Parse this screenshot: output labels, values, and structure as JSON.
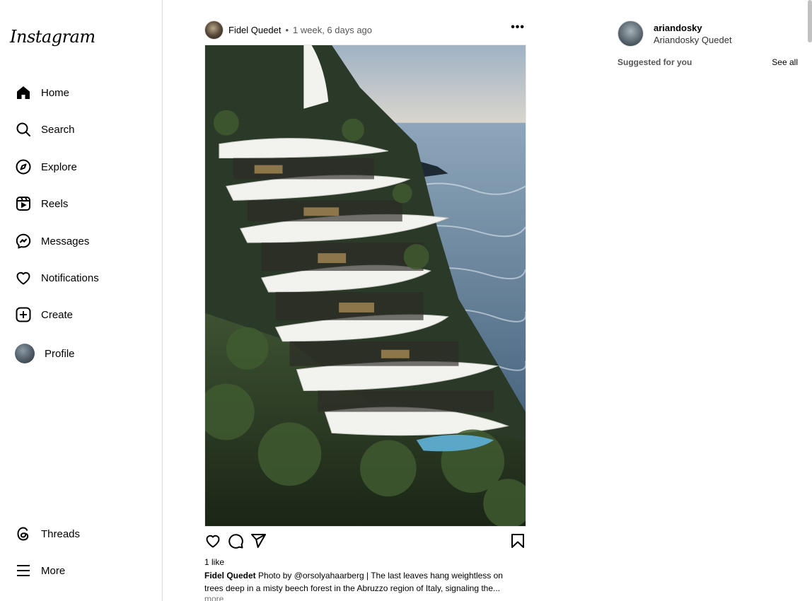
{
  "brand": {
    "logo_text": "Instagram"
  },
  "sidebar": {
    "items": [
      {
        "label": "Home",
        "icon": "home-icon"
      },
      {
        "label": "Search",
        "icon": "search-icon"
      },
      {
        "label": "Explore",
        "icon": "compass-icon"
      },
      {
        "label": "Reels",
        "icon": "reels-icon"
      },
      {
        "label": "Messages",
        "icon": "messenger-icon"
      },
      {
        "label": "Notifications",
        "icon": "heart-icon"
      },
      {
        "label": "Create",
        "icon": "plus-square-icon"
      },
      {
        "label": "Profile",
        "icon": "avatar"
      }
    ],
    "bottom": [
      {
        "label": "Threads",
        "icon": "threads-icon"
      },
      {
        "label": "More",
        "icon": "hamburger-icon"
      }
    ]
  },
  "post": {
    "username": "Fidel Quedet",
    "separator": "•",
    "time": "1 week, 6 days ago",
    "more": "•••",
    "likes": "1 like",
    "caption_user": "Fidel Quedet",
    "caption_text": "Photo by @orsolyahaarberg | The last leaves hang weightless on trees deep in a misty beech forest in the Abruzzo region of Italy, signaling the...",
    "more_label": "more"
  },
  "me": {
    "username": "ariandosky",
    "full_name": "Ariandosky Quedet"
  },
  "suggestions": {
    "title": "Suggested for you",
    "see_all": "See all"
  }
}
